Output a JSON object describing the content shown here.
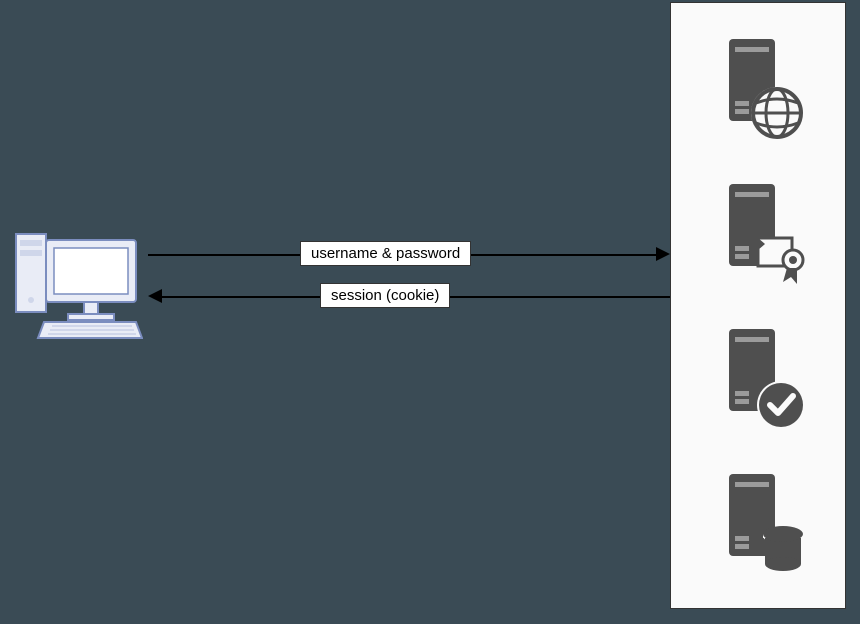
{
  "labels": {
    "request": "username & password",
    "response": "session (cookie)"
  },
  "icons": {
    "client": "client-computer",
    "servers": [
      "web-server",
      "auth-server",
      "validation-server",
      "database-server"
    ]
  },
  "colors": {
    "bg": "#3a4b55",
    "panel": "#fafafa",
    "ink": "#4f4f4f",
    "client_stroke": "#7b8dbf",
    "client_fill": "#e9ecf6"
  }
}
